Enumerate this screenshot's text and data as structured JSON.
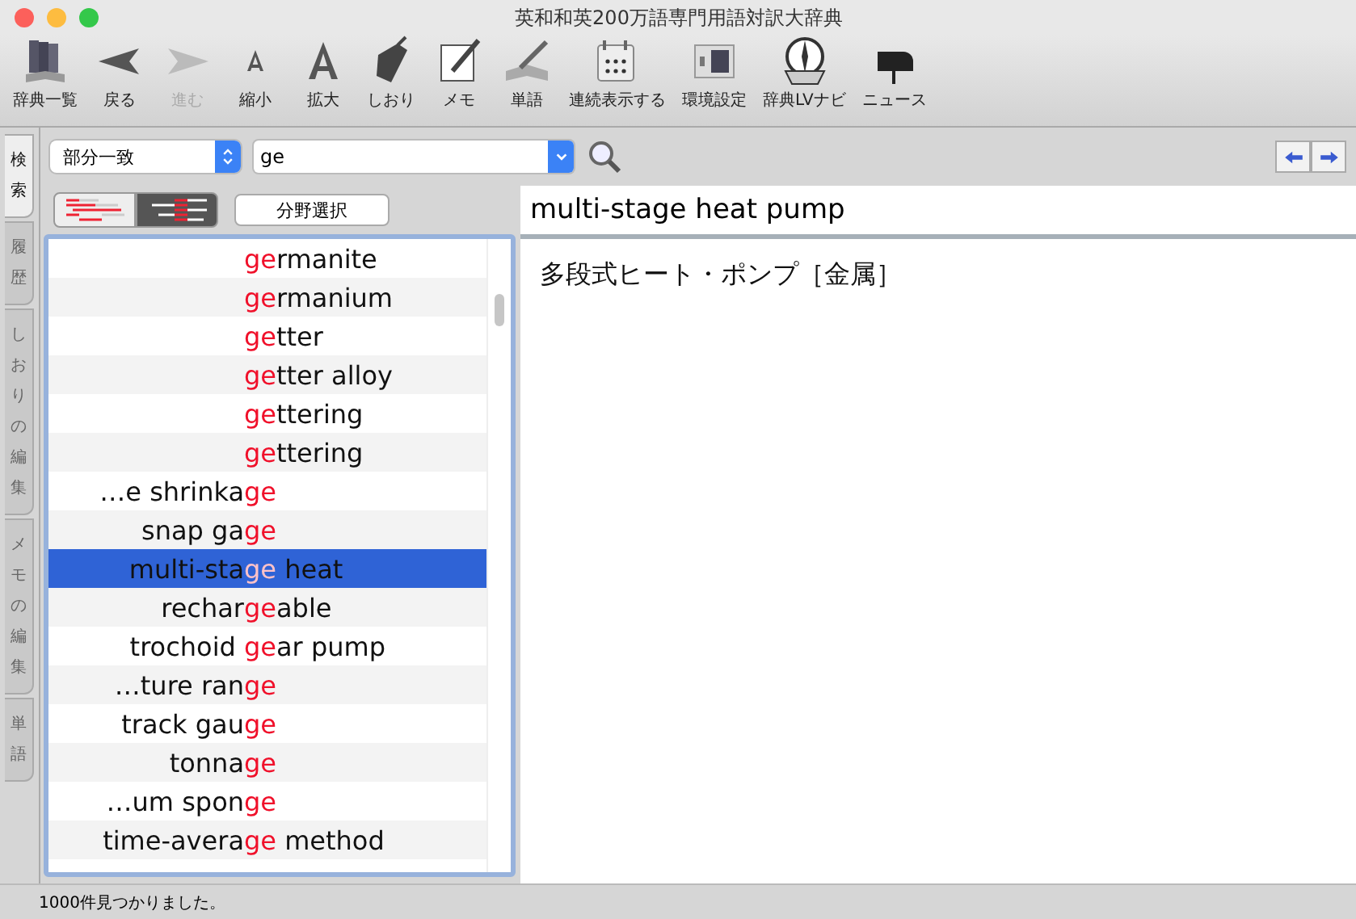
{
  "window": {
    "title": "英和和英200万語専門用語対訳大辞典"
  },
  "toolbar": [
    {
      "label": "辞典一覧",
      "kind": "books",
      "disabled": false
    },
    {
      "label": "戻る",
      "kind": "back",
      "disabled": false
    },
    {
      "label": "進む",
      "kind": "forward",
      "disabled": true
    },
    {
      "label": "縮小",
      "kind": "small-a",
      "disabled": false
    },
    {
      "label": "拡大",
      "kind": "big-a",
      "disabled": false
    },
    {
      "label": "しおり",
      "kind": "tag",
      "disabled": false
    },
    {
      "label": "メモ",
      "kind": "memo",
      "disabled": false
    },
    {
      "label": "単語",
      "kind": "pen",
      "disabled": false
    },
    {
      "label": "連続表示する",
      "kind": "calendar",
      "disabled": false
    },
    {
      "label": "環境設定",
      "kind": "settings",
      "disabled": false
    },
    {
      "label": "辞典LVナビ",
      "kind": "compass",
      "disabled": false
    },
    {
      "label": "ニュース",
      "kind": "mailbox",
      "disabled": false
    }
  ],
  "side_tabs": [
    {
      "label": "検索",
      "selected": true
    },
    {
      "label": "履歴",
      "selected": false
    },
    {
      "label": "しおりの編集",
      "selected": false
    },
    {
      "label": "メモの編集",
      "selected": false
    },
    {
      "label": "単語",
      "selected": false
    }
  ],
  "search": {
    "mode": "部分一致",
    "query": "ge"
  },
  "view_modes": [
    {
      "selected": false
    },
    {
      "selected": true
    }
  ],
  "field_button": "分野選択",
  "results": [
    {
      "match": "ge",
      "after": "rmanite",
      "selected": false
    },
    {
      "match": "ge",
      "after": "rmanium",
      "selected": false
    },
    {
      "match": "ge",
      "after": "tter",
      "selected": false
    },
    {
      "match": "ge",
      "after": "tter alloy",
      "selected": false
    },
    {
      "match": "ge",
      "after": "ttering",
      "selected": false
    },
    {
      "match": "ge",
      "after": "ttering",
      "selected": false
    },
    {
      "before": "…e shrinka",
      "match": "ge",
      "selected": false
    },
    {
      "before": "snap ga",
      "match": "ge",
      "selected": false
    },
    {
      "before": "multi-sta",
      "match": "ge",
      "after": " heat",
      "selected": true
    },
    {
      "before": "rechar",
      "match": "ge",
      "after": "able",
      "selected": false
    },
    {
      "before": "trochoid ",
      "match": "ge",
      "after": "ar pump",
      "selected": false
    },
    {
      "before": "…ture ran",
      "match": "ge",
      "selected": false
    },
    {
      "before": "track gau",
      "match": "ge",
      "selected": false
    },
    {
      "before": "tonna",
      "match": "ge",
      "selected": false
    },
    {
      "before": "…um spon",
      "match": "ge",
      "selected": false
    },
    {
      "before": "time-avera",
      "match": "ge",
      "after": " method",
      "selected": false
    }
  ],
  "entry": {
    "headword": "multi-stage heat pump",
    "translation": "多段式ヒート・ポンプ［金属］"
  },
  "status_bar": "1000件見つかりました。"
}
